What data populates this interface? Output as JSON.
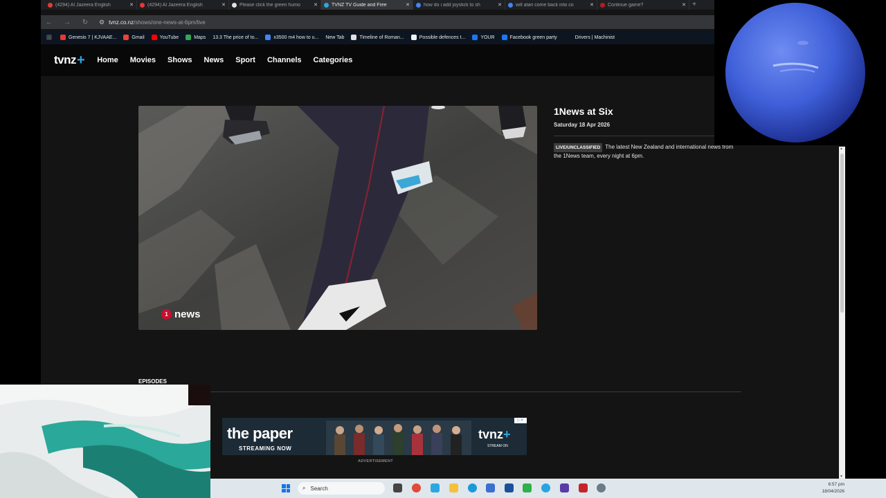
{
  "browser": {
    "tabs": [
      {
        "label": "(4294) Al Jazeera English",
        "favicon_color": "#e53935",
        "active": false
      },
      {
        "label": "(4294) Al Jazeera English",
        "favicon_color": "#e53935",
        "active": false
      },
      {
        "label": "Please click the green humo",
        "favicon_color": "#e0e0e0",
        "active": false
      },
      {
        "label": "TVNZ TV Guide and Free",
        "favicon_color": "#2ea7e0",
        "active": true
      },
      {
        "label": "how do i add joystick to sh",
        "favicon_color": "#4285f4",
        "active": false
      },
      {
        "label": "will atari come back into co",
        "favicon_color": "#4285f4",
        "active": false
      },
      {
        "label": "Continue game?",
        "favicon_color": "#b71c1c",
        "active": false
      }
    ],
    "url_host": "tvnz.co.nz",
    "url_path": "/shows/one-news-at-6pm/live",
    "bookmarks": [
      {
        "label": "Genesis 7 | KJVAAE...",
        "color": "#e53935"
      },
      {
        "label": "Gmail",
        "color": "#ea4335"
      },
      {
        "label": "YouTube",
        "color": "#ff0000"
      },
      {
        "label": "Maps",
        "color": "#34a853"
      },
      {
        "label": "13.3 The price of to...",
        "color": "#1a2a3a"
      },
      {
        "label": "x3500 m4 how to u...",
        "color": "#4285f4"
      },
      {
        "label": "New Tab",
        "color": "#1a2a3a"
      },
      {
        "label": "Timeline of Roman...",
        "color": "#e0e0e0"
      },
      {
        "label": "Possible defences t...",
        "color": "#f0f0f0"
      },
      {
        "label": "YOUR",
        "color": "#1877f2"
      },
      {
        "label": "Facebook green party",
        "color": "#1877f2"
      },
      {
        "label": "Drivers | Machinist",
        "color": "#1a2a3a"
      }
    ]
  },
  "site": {
    "logo_text": "tvnz",
    "logo_plus": "+",
    "nav": [
      "Home",
      "Movies",
      "Shows",
      "News",
      "Sport",
      "Channels",
      "Categories"
    ]
  },
  "show": {
    "title": "1News at Six",
    "date": "Saturday 18 Apr 2026",
    "badge": "LIVE/UNCLASSIFIED",
    "description": "The latest New Zealand and international news from the 1News team, every night at 6pm."
  },
  "player": {
    "bug_number": "1",
    "bug_text": "news"
  },
  "episodes_heading": "EPISODES",
  "ad": {
    "title": "the paper",
    "subtitle": "STREAMING NOW",
    "brand": "tvnz",
    "brand_plus": "+",
    "brand_sub": "STREAM ON",
    "label": "ADVERTISEMENT"
  },
  "taskbar": {
    "search_placeholder": "Search",
    "time": "6:57 pm",
    "date": "18/04/2026"
  },
  "colors": {
    "accent": "#2ea7e0",
    "news_red": "#c8102e"
  }
}
